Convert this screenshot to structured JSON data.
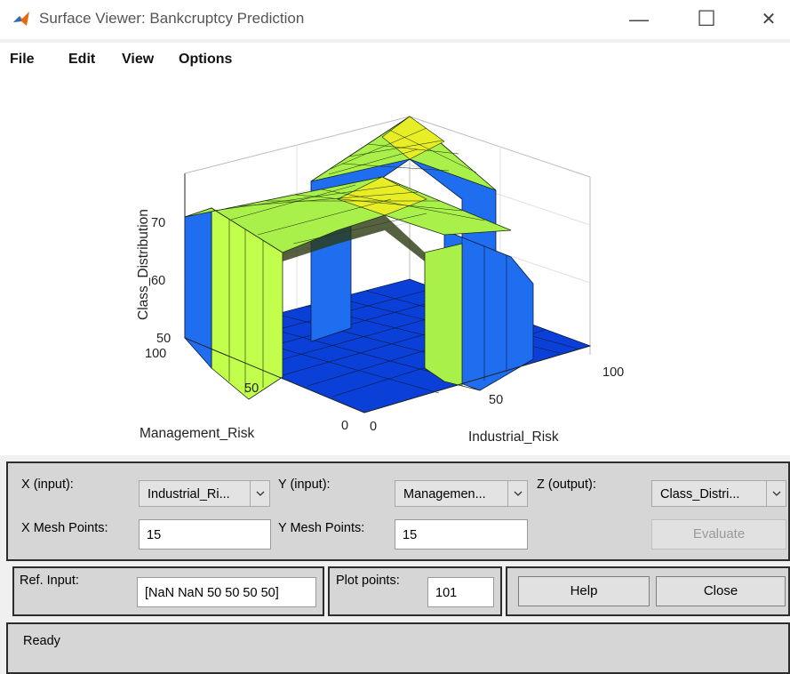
{
  "window": {
    "title": "Surface Viewer: Bankcruptcy Prediction",
    "minimize": "—",
    "maximize": "☐",
    "close": "✕"
  },
  "menu": [
    "File",
    "Edit",
    "View",
    "Options"
  ],
  "chart_data": {
    "type": "surface",
    "xlabel": "Industrial_Risk",
    "ylabel": "Management_Risk",
    "zlabel": "Class_Distribution",
    "xlim": [
      0,
      100
    ],
    "ylim": [
      0,
      100
    ],
    "zlim": [
      50,
      75
    ],
    "x_ticks": [
      "0",
      "50",
      "100"
    ],
    "y_ticks": [
      "0",
      "50",
      "100"
    ],
    "z_ticks": [
      "50",
      "60",
      "70"
    ],
    "mesh_points": [
      15,
      15
    ],
    "z_base": 50,
    "z_plateau_approx": 70,
    "z_peak_approx": 75
  },
  "controls": {
    "x_input_label": "X (input):",
    "x_input_value": "Industrial_Ri...",
    "y_input_label": "Y (input):",
    "y_input_value": "Managemen...",
    "z_output_label": "Z (output):",
    "z_output_value": "Class_Distri...",
    "x_mesh_label": "X Mesh Points:",
    "x_mesh_value": "15",
    "y_mesh_label": "Y Mesh Points:",
    "y_mesh_value": "15",
    "evaluate_label": "Evaluate",
    "ref_input_label": "Ref. Input:",
    "ref_input_value": "[NaN NaN 50 50 50 50]",
    "plot_points_label": "Plot points:",
    "plot_points_value": "101",
    "help_label": "Help",
    "close_label": "Close"
  },
  "status": "Ready",
  "colors": {
    "surface_low": "#0a40d8",
    "surface_mid": "#2a86ee",
    "surface_wall": "#c2ff4c",
    "surface_high": "#e8ee25"
  }
}
